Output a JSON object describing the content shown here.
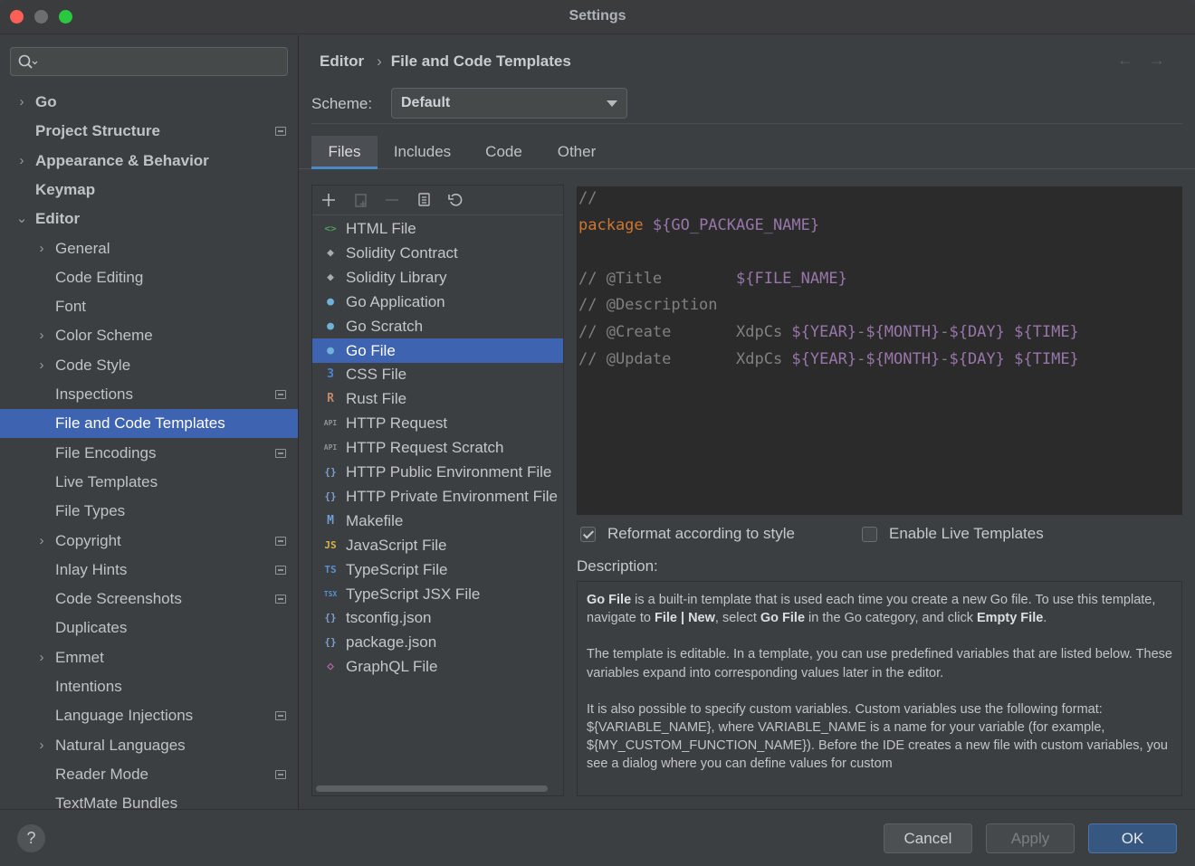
{
  "window": {
    "title": "Settings"
  },
  "sidebar": {
    "search_placeholder": "",
    "items": [
      {
        "label": "Go",
        "arrow": "›",
        "bold": true
      },
      {
        "label": "Project Structure",
        "arrow": "",
        "bold": true,
        "project_icon": true
      },
      {
        "label": "Appearance & Behavior",
        "arrow": "›",
        "bold": true
      },
      {
        "label": "Keymap",
        "arrow": "",
        "bold": true
      },
      {
        "label": "Editor",
        "arrow": "⌄",
        "bold": true
      },
      {
        "label": "General",
        "arrow": "›"
      },
      {
        "label": "Code Editing",
        "arrow": ""
      },
      {
        "label": "Font",
        "arrow": ""
      },
      {
        "label": "Color Scheme",
        "arrow": "›"
      },
      {
        "label": "Code Style",
        "arrow": "›"
      },
      {
        "label": "Inspections",
        "arrow": "",
        "project_icon": true
      },
      {
        "label": "File and Code Templates",
        "arrow": "",
        "selected": true
      },
      {
        "label": "File Encodings",
        "arrow": "",
        "project_icon": true
      },
      {
        "label": "Live Templates",
        "arrow": ""
      },
      {
        "label": "File Types",
        "arrow": ""
      },
      {
        "label": "Copyright",
        "arrow": "›",
        "project_icon": true
      },
      {
        "label": "Inlay Hints",
        "arrow": "",
        "project_icon": true
      },
      {
        "label": "Code Screenshots",
        "arrow": "",
        "project_icon": true
      },
      {
        "label": "Duplicates",
        "arrow": ""
      },
      {
        "label": "Emmet",
        "arrow": "›"
      },
      {
        "label": "Intentions",
        "arrow": ""
      },
      {
        "label": "Language Injections",
        "arrow": "",
        "project_icon": true
      },
      {
        "label": "Natural Languages",
        "arrow": "›"
      },
      {
        "label": "Reader Mode",
        "arrow": "",
        "project_icon": true
      },
      {
        "label": "TextMate Bundles",
        "arrow": ""
      }
    ]
  },
  "breadcrumb": {
    "parent": "Editor",
    "separator": "›",
    "current": "File and Code Templates"
  },
  "nav": {
    "back": "←",
    "forward": "→"
  },
  "scheme": {
    "label": "Scheme:",
    "value": "Default"
  },
  "tabs": [
    {
      "label": "Files",
      "active": true
    },
    {
      "label": "Includes"
    },
    {
      "label": "Code"
    },
    {
      "label": "Other"
    }
  ],
  "files": [
    {
      "name": "HTML File",
      "icon": "html-icon",
      "glyph": "<>",
      "color": "#4f9e5c"
    },
    {
      "name": "Solidity Contract",
      "icon": "solidity-icon",
      "glyph": "◆",
      "color": "#a9acaf"
    },
    {
      "name": "Solidity Library",
      "icon": "solidity-icon",
      "glyph": "◆",
      "color": "#a9acaf"
    },
    {
      "name": "Go Application",
      "icon": "gopher-icon",
      "glyph": "●",
      "color": "#6fb2d8"
    },
    {
      "name": "Go Scratch",
      "icon": "gopher-icon",
      "glyph": "●",
      "color": "#6fb2d8"
    },
    {
      "name": "Go File",
      "icon": "gopher-icon",
      "glyph": "●",
      "color": "#6fb2d8",
      "selected": true
    },
    {
      "name": "CSS File",
      "icon": "css-icon",
      "glyph": "3",
      "color": "#4d84d6"
    },
    {
      "name": "Rust File",
      "icon": "rust-icon",
      "glyph": "R",
      "color": "#c28a6a"
    },
    {
      "name": "HTTP Request",
      "icon": "api-icon",
      "glyph": "API",
      "color": "#8f9396"
    },
    {
      "name": "HTTP Request Scratch",
      "icon": "api-icon",
      "glyph": "API",
      "color": "#8f9396"
    },
    {
      "name": "HTTP Public Environment File",
      "icon": "braces-icon",
      "glyph": "{}",
      "color": "#7d9fcc"
    },
    {
      "name": "HTTP Private Environment File",
      "icon": "braces-icon",
      "glyph": "{}",
      "color": "#7d9fcc"
    },
    {
      "name": "Makefile",
      "icon": "makefile-icon",
      "glyph": "M",
      "color": "#6e9fd6"
    },
    {
      "name": "JavaScript File",
      "icon": "js-icon",
      "glyph": "JS",
      "color": "#d4b64a"
    },
    {
      "name": "TypeScript File",
      "icon": "ts-icon",
      "glyph": "TS",
      "color": "#5b8fd6"
    },
    {
      "name": "TypeScript JSX File",
      "icon": "tsx-icon",
      "glyph": "TSX",
      "color": "#5b8fd6"
    },
    {
      "name": "tsconfig.json",
      "icon": "braces-icon",
      "glyph": "{}",
      "color": "#7d9fcc"
    },
    {
      "name": "package.json",
      "icon": "braces-icon",
      "glyph": "{}",
      "color": "#7d9fcc"
    },
    {
      "name": "GraphQL File",
      "icon": "graphql-icon",
      "glyph": "◇",
      "color": "#c76ab8"
    }
  ],
  "editor": {
    "lines": [
      [
        {
          "t": "//",
          "c": "cmt"
        }
      ],
      [
        {
          "t": "package ",
          "c": "kw"
        },
        {
          "t": "${GO_PACKAGE_NAME}",
          "c": "var"
        }
      ],
      [],
      [
        {
          "t": "// @Title        ",
          "c": "cmt"
        },
        {
          "t": "${FILE_NAME}",
          "c": "var"
        }
      ],
      [
        {
          "t": "// @Description",
          "c": "cmt"
        }
      ],
      [
        {
          "t": "// @Create       ",
          "c": "cmt"
        },
        {
          "t": "XdpCs ",
          "c": "cmt"
        },
        {
          "t": "${YEAR}",
          "c": "var"
        },
        {
          "t": "-",
          "c": "cmt"
        },
        {
          "t": "${MONTH}",
          "c": "var"
        },
        {
          "t": "-",
          "c": "cmt"
        },
        {
          "t": "${DAY}",
          "c": "var"
        },
        {
          "t": " ",
          "c": "cmt"
        },
        {
          "t": "${TIME}",
          "c": "var"
        }
      ],
      [
        {
          "t": "// @Update       ",
          "c": "cmt"
        },
        {
          "t": "XdpCs ",
          "c": "cmt"
        },
        {
          "t": "${YEAR}",
          "c": "var"
        },
        {
          "t": "-",
          "c": "cmt"
        },
        {
          "t": "${MONTH}",
          "c": "var"
        },
        {
          "t": "-",
          "c": "cmt"
        },
        {
          "t": "${DAY}",
          "c": "var"
        },
        {
          "t": " ",
          "c": "cmt"
        },
        {
          "t": "${TIME}",
          "c": "var"
        }
      ]
    ]
  },
  "options": {
    "reformat": {
      "label": "Reformat according to style",
      "checked": true
    },
    "live_templates": {
      "label": "Enable Live Templates",
      "checked": false
    }
  },
  "description": {
    "label": "Description:",
    "paragraphs": [
      [
        {
          "b": "Go File"
        },
        " is a built-in template that is used each time you create a new Go file. To use this template, navigate to ",
        {
          "b": "File | New"
        },
        ", select ",
        {
          "b": "Go File"
        },
        " in the Go category, and click ",
        {
          "b": "Empty File"
        },
        "."
      ],
      [
        "The template is editable. In a template, you can use predefined variables that are listed below. These variables expand into corresponding values later in the editor."
      ],
      [
        "It is also possible to specify custom variables. Custom variables use the following format: ${VARIABLE_NAME}, where VARIABLE_NAME is a name for your variable (for example, ${MY_CUSTOM_FUNCTION_NAME}). Before the IDE creates a new file with custom variables, you see a dialog where you can define values for custom"
      ]
    ]
  },
  "footer": {
    "help": "?",
    "cancel": "Cancel",
    "apply": "Apply",
    "ok": "OK"
  }
}
